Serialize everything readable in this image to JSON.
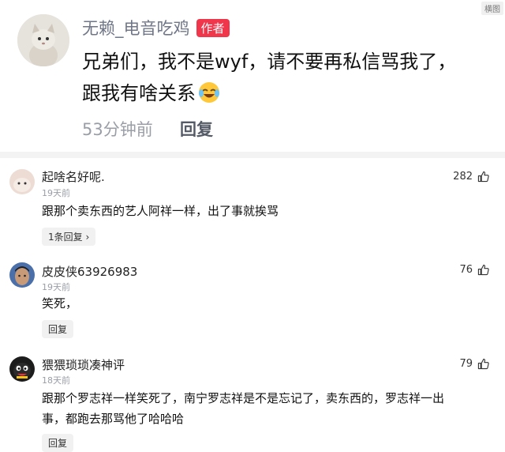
{
  "watermark": "横图",
  "top_comment": {
    "author": "无赖_电音吃鸡",
    "badge": "作者",
    "body_line1": "兄弟们，我不是wyf，请不要再私信骂我了，",
    "body_line2": "跟我有啥关系",
    "time": "53分钟前",
    "reply_label": "回复"
  },
  "comments": [
    {
      "name": "起啥名好呢.",
      "time": "19天前",
      "text": "跟那个卖东西的艺人阿祥一样，出了事就挨骂",
      "likes": "282",
      "pill": "1条回复 ›"
    },
    {
      "name": "皮皮侠63926983",
      "time": "19天前",
      "text": "笑死，",
      "likes": "76",
      "pill": "回复"
    },
    {
      "name": "猥猥琐琐凑神评",
      "time": "18天前",
      "text_line1": "跟那个罗志祥一样笑死了，南宁罗志祥是不是忘记了，卖东西的，罗志祥一出",
      "text_line2": "事，都跑去那骂他了哈哈哈",
      "likes": "79",
      "pill": "回复"
    }
  ],
  "colors": {
    "accent": "#f0364b",
    "meta": "#9a9ea6"
  }
}
